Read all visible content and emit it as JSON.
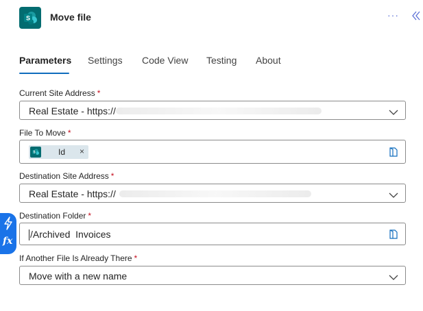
{
  "header": {
    "title": "Move file",
    "more_label": "···",
    "app_icon": "sharepoint-icon",
    "collapse_icon": "collapse-panel-icon"
  },
  "tabs": [
    {
      "label": "Parameters",
      "active": true
    },
    {
      "label": "Settings",
      "active": false
    },
    {
      "label": "Code View",
      "active": false
    },
    {
      "label": "Testing",
      "active": false
    },
    {
      "label": "About",
      "active": false
    }
  ],
  "fields": {
    "current_site": {
      "label": "Current Site Address",
      "required": "*",
      "value": "Real Estate - https://"
    },
    "file_to_move": {
      "label": "File To Move",
      "required": "*",
      "token_label": "Id",
      "token_remove": "×"
    },
    "destination_site": {
      "label": "Destination Site Address",
      "required": "*",
      "value": "Real Estate - https://"
    },
    "destination_folder": {
      "label": "Destination Folder",
      "required": "*",
      "value": "/Archived  Invoices"
    },
    "if_file_exists": {
      "label": "If Another File Is Already There",
      "required": "*",
      "value": "Move with a new name"
    }
  },
  "side_tools": {
    "fx_label": "fx"
  },
  "colors": {
    "accent": "#0f6cbd",
    "sharepoint": "#036c70",
    "required": "#c50f1f",
    "side_tools": "#1a73e8"
  }
}
